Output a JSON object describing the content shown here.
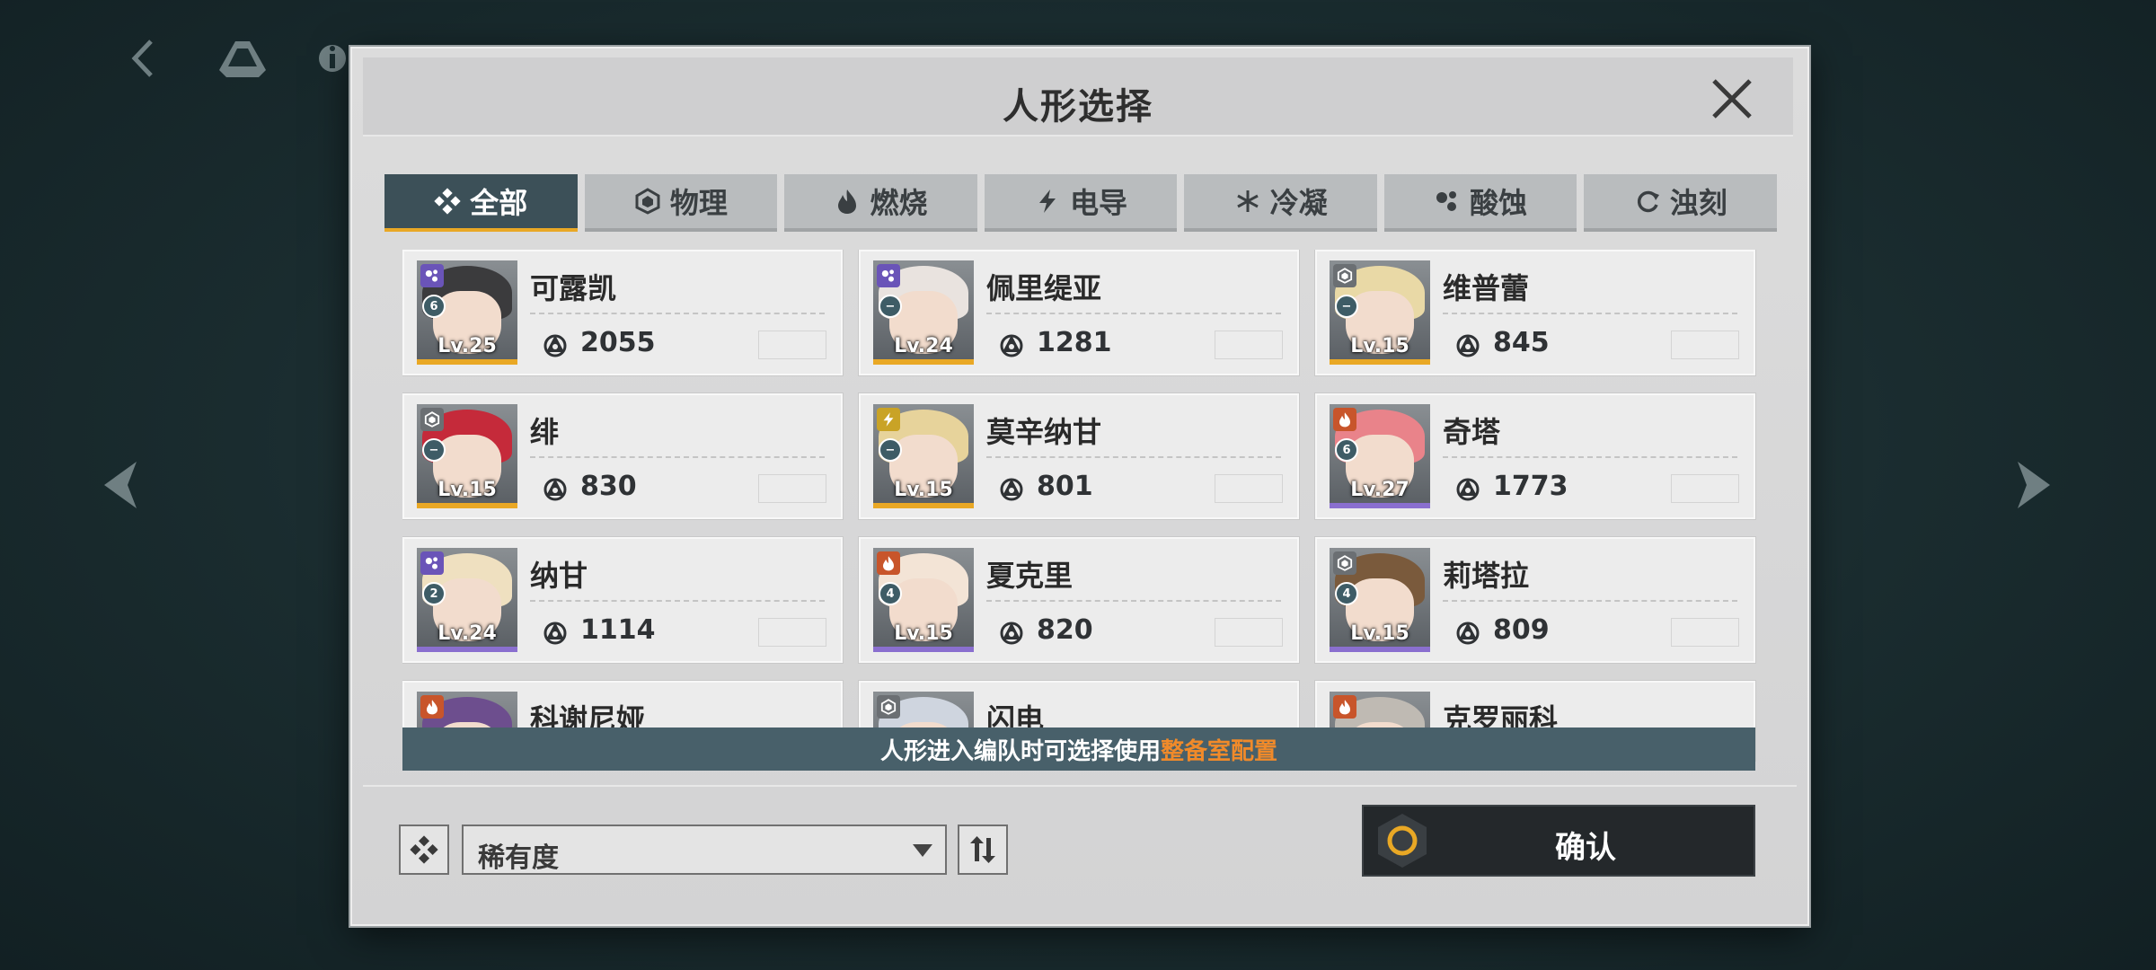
{
  "dialog": {
    "title": "人形选择",
    "close_label": "关闭"
  },
  "tabs": [
    {
      "label": "全部",
      "icon": "all-diamond-icon",
      "active": true
    },
    {
      "label": "物理",
      "icon": "physical-hex-icon",
      "active": false
    },
    {
      "label": "燃烧",
      "icon": "fire-icon",
      "active": false
    },
    {
      "label": "电导",
      "icon": "lightning-icon",
      "active": false
    },
    {
      "label": "冷凝",
      "icon": "snowflake-icon",
      "active": false
    },
    {
      "label": "酸蚀",
      "icon": "acid-drops-icon",
      "active": false
    },
    {
      "label": "浊刻",
      "icon": "corrosion-swirl-icon",
      "active": false
    }
  ],
  "characters": [
    {
      "name": "可露凯",
      "level": "Lv.25",
      "power": "2055",
      "element": "acid",
      "neural": "6",
      "rarity": "gold",
      "hair": "#3b3b3d"
    },
    {
      "name": "佩里缇亚",
      "level": "Lv.24",
      "power": "1281",
      "element": "acid",
      "neural": "−",
      "rarity": "gold",
      "hair": "#e9e3df"
    },
    {
      "name": "维普蕾",
      "level": "Lv.15",
      "power": "845",
      "element": "physical",
      "neural": "−",
      "rarity": "gold",
      "hair": "#e9d9a6"
    },
    {
      "name": "绯",
      "level": "Lv.15",
      "power": "830",
      "element": "physical",
      "neural": "−",
      "rarity": "gold",
      "hair": "#c52a3a"
    },
    {
      "name": "莫辛纳甘",
      "level": "Lv.15",
      "power": "801",
      "element": "electric",
      "neural": "−",
      "rarity": "gold",
      "hair": "#e7d39b"
    },
    {
      "name": "奇塔",
      "level": "Lv.27",
      "power": "1773",
      "element": "fire",
      "neural": "6",
      "rarity": "purple",
      "hair": "#e9838a"
    },
    {
      "name": "纳甘",
      "level": "Lv.24",
      "power": "1114",
      "element": "acid",
      "neural": "2",
      "rarity": "purple",
      "hair": "#efe0c0"
    },
    {
      "name": "夏克里",
      "level": "Lv.15",
      "power": "820",
      "element": "fire",
      "neural": "4",
      "rarity": "purple",
      "hair": "#f3e4d6"
    },
    {
      "name": "莉塔拉",
      "level": "Lv.15",
      "power": "809",
      "element": "physical",
      "neural": "4",
      "rarity": "purple",
      "hair": "#7a5a3c"
    },
    {
      "name": "科谢尼娅",
      "level": "",
      "power": "",
      "element": "fire",
      "neural": "",
      "rarity": "purple",
      "hair": "#6d4e8e"
    },
    {
      "name": "闪电",
      "level": "",
      "power": "",
      "element": "physical",
      "neural": "",
      "rarity": "purple",
      "hair": "#cfd5df"
    },
    {
      "name": "克罗丽科",
      "level": "",
      "power": "",
      "element": "fire",
      "neural": "",
      "rarity": "purple",
      "hair": "#bfbab3"
    }
  ],
  "notice": {
    "text": "人形进入编队时可选择使用",
    "highlight": "整备室配置"
  },
  "footer": {
    "sort_label": "稀有度",
    "confirm_label": "确认"
  },
  "colors": {
    "active_tab": "#3c5058",
    "tab_underline": "#e9a825",
    "gold": "#e9a825",
    "purple": "#8a6fcf",
    "acid": "#6a54b8",
    "physical": "#6b6f73",
    "fire": "#c8552b",
    "electric": "#c9a326",
    "notice_highlight": "#f08a2a"
  }
}
